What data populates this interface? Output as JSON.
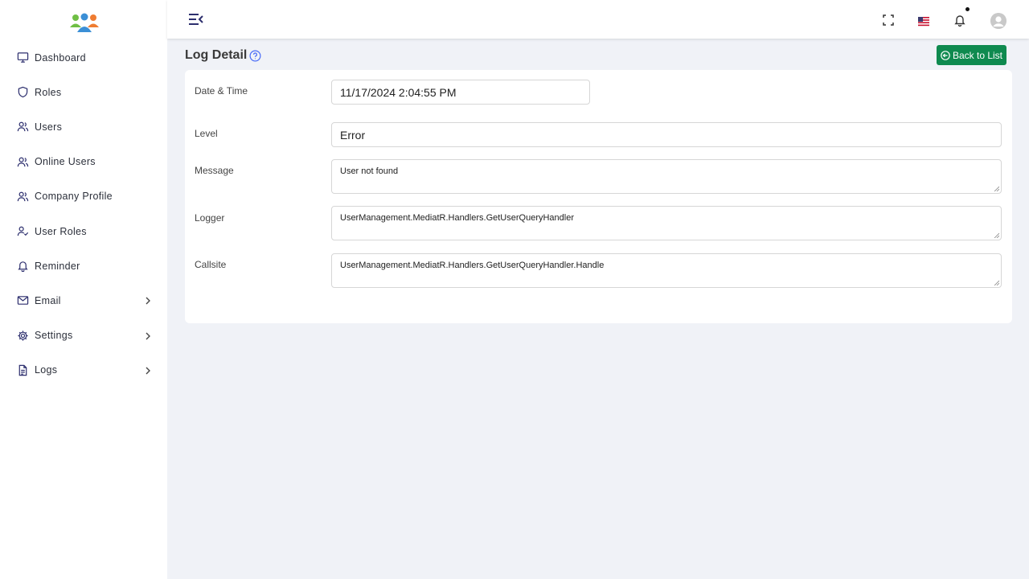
{
  "sidebar": {
    "items": [
      {
        "label": "Dashboard"
      },
      {
        "label": "Roles"
      },
      {
        "label": "Users"
      },
      {
        "label": "Online Users"
      },
      {
        "label": "Company Profile"
      },
      {
        "label": "User Roles"
      },
      {
        "label": "Reminder"
      },
      {
        "label": "Email"
      },
      {
        "label": "Settings"
      },
      {
        "label": "Logs"
      }
    ]
  },
  "page": {
    "title": "Log Detail",
    "back_label": "Back to List"
  },
  "form": {
    "date_label": "Date & Time",
    "date_value": "11/17/2024 2:04:55 PM",
    "level_label": "Level",
    "level_value": "Error",
    "message_label": "Message",
    "message_value": "User not found",
    "logger_label": "Logger",
    "logger_value": "UserManagement.MediatR.Handlers.GetUserQueryHandler",
    "callsite_label": "Callsite",
    "callsite_value": "UserManagement.MediatR.Handlers.GetUserQueryHandler.Handle"
  },
  "colors": {
    "accent": "#0f8a4f",
    "sidebar_bg": "#ffffff",
    "content_bg": "#f0f2f7",
    "icon": "#2d2f6e"
  },
  "icons": {
    "logo": "people-group-icon",
    "menu_toggle": "menu-collapse-icon",
    "fullscreen": "fullscreen-icon",
    "language": "us-flag-icon",
    "notifications": "bell-icon",
    "user": "avatar-icon",
    "help": "question-circle-icon"
  }
}
